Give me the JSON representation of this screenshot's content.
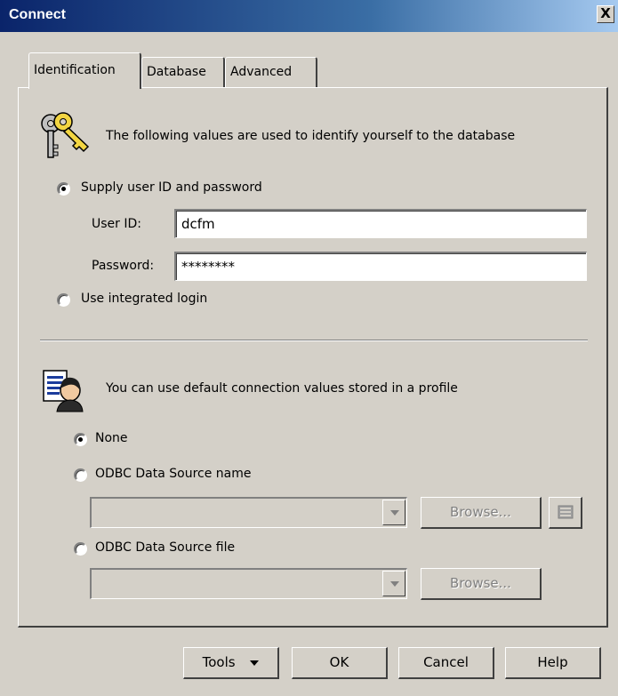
{
  "window": {
    "title": "Connect",
    "close_symbol": "X"
  },
  "tabs": [
    {
      "label": "Identification"
    },
    {
      "label": "Database"
    },
    {
      "label": "Advanced"
    }
  ],
  "identification": {
    "icon": "keys-icon",
    "intro": "The following values are used to identify yourself to the database",
    "supply_option": {
      "label": "Supply user ID and password",
      "selected": true
    },
    "user_id": {
      "label": "User ID:",
      "value": "dcfm"
    },
    "password": {
      "label": "Password:",
      "value": "********"
    },
    "integrated_option": {
      "label": "Use integrated login",
      "selected": false
    }
  },
  "profile": {
    "icon": "profile-person-icon",
    "intro": "You can use default connection values stored in a profile",
    "none_option": {
      "label": "None",
      "selected": true
    },
    "dsn_option": {
      "label": "ODBC Data Source name",
      "selected": false
    },
    "dsn_select": {
      "value": ""
    },
    "dsn_browse": "Browse...",
    "dsn_admin_icon": "odbc-administrator-icon",
    "file_option": {
      "label": "ODBC Data Source file",
      "selected": false
    },
    "file_select": {
      "value": ""
    },
    "file_browse": "Browse..."
  },
  "buttons": {
    "tools": "Tools",
    "ok": "OK",
    "cancel": "Cancel",
    "help": "Help"
  }
}
